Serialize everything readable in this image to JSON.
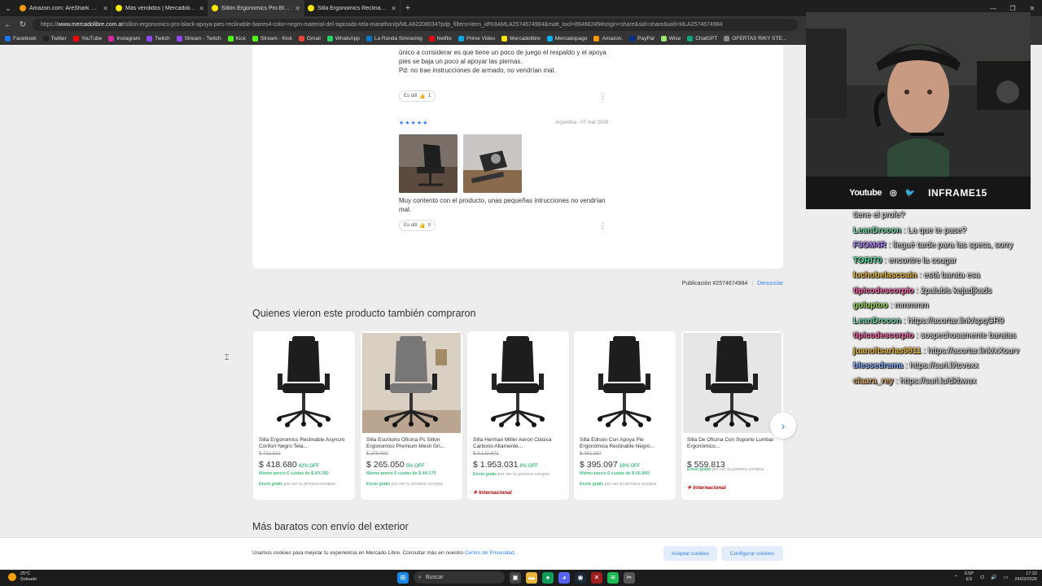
{
  "browser": {
    "tabs": [
      {
        "title": "Amazon.com: AreShark Silla de ofi",
        "active": false,
        "color": "#ff9900"
      },
      {
        "title": "Más vendidos | Mercadolibre Arge",
        "active": false,
        "color": "#ffe600"
      },
      {
        "title": "Sillón Ergonomics Pro Black Apoya",
        "active": true,
        "color": "#ffe600"
      },
      {
        "title": "Silla Ergonomics Reclinable Asyn",
        "active": false,
        "color": "#ffe600"
      }
    ],
    "url_prefix": "https://",
    "url_domain": "www.mercadolibre.com.ar",
    "url_path": "/sillon-ergonomics-pro-black-apoya-pies-reclinable-baires4-color-negro-material-del-tapizado-tela-marathon/p/MLA62208034?pdp_filters=item_id%3AMLA2574674984&matt_tool=89488245#origin=share&sid=share&wid=MLA2574674984",
    "bookmarks": [
      {
        "label": "Facebook",
        "color": "#1877f2"
      },
      {
        "label": "Twitter",
        "color": "#222222"
      },
      {
        "label": "YouTube",
        "color": "#ff0000"
      },
      {
        "label": "Instagram",
        "color": "#d6249f"
      },
      {
        "label": "Twitch",
        "color": "#9146ff"
      },
      {
        "label": "Stream - Twitch",
        "color": "#9146ff"
      },
      {
        "label": "Kick",
        "color": "#53fc18"
      },
      {
        "label": "Stream - Kick",
        "color": "#53fc18"
      },
      {
        "label": "Gmail",
        "color": "#ea4335"
      },
      {
        "label": "WhatsApp",
        "color": "#25d366"
      },
      {
        "label": "La Ronda Simracing",
        "color": "#0077cc"
      },
      {
        "label": "Netflix",
        "color": "#e50914"
      },
      {
        "label": "Prime Video",
        "color": "#00a8e1"
      },
      {
        "label": "Mercadolibre",
        "color": "#ffe600"
      },
      {
        "label": "Mercadopago",
        "color": "#00b1ea"
      },
      {
        "label": "Amazon.",
        "color": "#ff9900"
      },
      {
        "label": "PayPal",
        "color": "#003087"
      },
      {
        "label": "Wise",
        "color": "#9fe870"
      },
      {
        "label": "ChatGPT",
        "color": "#10a37f"
      },
      {
        "label": "OFERTAS RIKY STE...",
        "color": "#888888"
      }
    ]
  },
  "reviews": {
    "review1_text": "único a considerar es que tiene un poco de juego el respaldo y el apoya pies se baja un poco al apoyar las piernas.\nPd: no trae instrucciones de armado, no vendrían mal.",
    "review1_useful": "Es útil",
    "review1_count": "1",
    "review2_stars": "★★★★★",
    "review2_meta": "Argentina · 07 mar 2026",
    "review2_text": "Muy contento con el producto, unas pequeñas intrucciones no vendrían mal.",
    "review2_useful": "Es útil",
    "review2_count": "0"
  },
  "publication": {
    "label": "Publicación #2574674984",
    "report": "Denunciar"
  },
  "section_title": "Quienes vieron este producto también compraron",
  "section2_title": "Más baratos con envío del exterior",
  "products": [
    {
      "name": "Silla Ergonomics Reclinable Asyncro Confort Negro Tela...",
      "old": "$ 731.621",
      "price": "$ 418.680",
      "disc": "42% OFF",
      "inst": "Mismo precio 6 cuotas de $ 69.780",
      "ship": "Envío gratis",
      "ship_rest": " por ser tu primera compra",
      "intl": ""
    },
    {
      "name": "Silla Escritorio Oficina Pc Sillon Ergonomico Premium Mesh Gri...",
      "old": "$ 279.000",
      "price": "$ 265.050",
      "disc": "5% OFF",
      "inst": "Mismo precio 6 cuotas de $ 44.175",
      "ship": "Envío gratis",
      "ship_rest": " por ser tu primera compra",
      "intl": ""
    },
    {
      "name": "Silla Herman Miller Aeron Clásica Carbono Altamente...",
      "old": "$ 2.122.871",
      "price": "$ 1.953.031",
      "disc": "8% OFF",
      "inst": "",
      "ship": "Envío gratis",
      "ship_rest": " por ser tu primera compra",
      "intl": "✈ Internacional"
    },
    {
      "name": "Silla Edison Con Apoya Pie Ergonómica Reclinable Negro...",
      "old": "$ 491.387",
      "price": "$ 395.097",
      "disc": "19% OFF",
      "inst": "Mismo precio 6 cuotas de $ 65.849",
      "ship": "Envío gratis",
      "ship_rest": " por ser tu primera compra",
      "intl": ""
    },
    {
      "name": "Silla De Oficina Con Soporte Lumbar Ergonómico...",
      "old": "",
      "price": "$ 559.813",
      "disc": "",
      "inst": "",
      "ship": "Envío gratis",
      "ship_rest": " por ser tu primera compra",
      "intl": "✈ Internacional"
    }
  ],
  "cookie": {
    "text": "Usamos cookies para mejorar tu experiencia en Mercado Libre. Consultar más en nuestro ",
    "link": "Centro de Privacidad",
    "accept": "Aceptar cookies",
    "configure": "Configurar cookies"
  },
  "taskbar": {
    "temp": "25°C",
    "weather": "Soleado",
    "search": "Buscar",
    "lang1": "ESP",
    "lang2": "ES",
    "time": "17:32",
    "date": "24/03/2026"
  },
  "stream": {
    "youtube": "Youtube",
    "channel": "INFRAME15",
    "chat": [
      {
        "user": "",
        "text": "tiene el profe?",
        "color": "#e8e8e8"
      },
      {
        "user": "LeanDrooon",
        "text": " : La que te pase?",
        "color": "#7ee0b0"
      },
      {
        "user": "F3OM4R",
        "text": " : llegué tarde para las specs, sorry",
        "color": "#b58cff"
      },
      {
        "user": "TORIT0",
        "text": " : encontre la cougar",
        "color": "#5ce0a0"
      },
      {
        "user": "luchobelascoain",
        "text": " : está barata esa",
        "color": "#f0c040"
      },
      {
        "user": "tipicodescorpio",
        "text": " : 2palubis kejadjkads",
        "color": "#ff6fb0"
      },
      {
        "user": "goluptoo",
        "text": " : mmmmm",
        "color": "#a0e060"
      },
      {
        "user": "LeanDrooon",
        "text": " : https://acortar.link/spqGR9",
        "color": "#7ee0b0"
      },
      {
        "user": "tipicodescorpio",
        "text": " : sospechosamente baratas",
        "color": "#ff6fb0"
      },
      {
        "user": "juanoltsarias9811",
        "text": " : https://acortar.link/xXourv",
        "color": "#f0c040"
      },
      {
        "user": "blessedrama",
        "text": " : https://surl.li/tcvoxx",
        "color": "#8ab4ff"
      },
      {
        "user": "claara_rey",
        "text": " : https://surl.lu/dkbwux",
        "color": "#e0b070"
      }
    ]
  }
}
